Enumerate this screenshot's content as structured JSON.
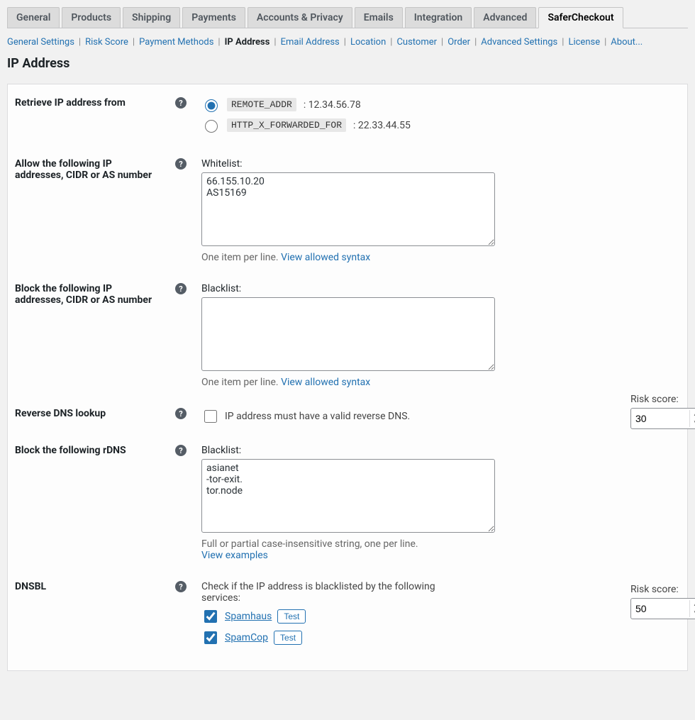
{
  "tabs": [
    "General",
    "Products",
    "Shipping",
    "Payments",
    "Accounts & Privacy",
    "Emails",
    "Integration",
    "Advanced",
    "SaferCheckout"
  ],
  "active_tab": 8,
  "subtabs": [
    "General Settings",
    "Risk Score",
    "Payment Methods",
    "IP Address",
    "Email Address",
    "Location",
    "Customer",
    "Order",
    "Advanced Settings",
    "License",
    "About..."
  ],
  "active_subtab": 3,
  "page_title": "IP Address",
  "retrieve": {
    "label": "Retrieve IP address from",
    "opts": [
      {
        "code": "REMOTE_ADDR",
        "ip": "12.34.56.78",
        "checked": true
      },
      {
        "code": "HTTP_X_FORWARDED_FOR",
        "ip": "22.33.44.55",
        "checked": false
      }
    ]
  },
  "whitelist": {
    "label": "Allow the following IP addresses, CIDR or AS number",
    "field_label": "Whitelist:",
    "value": "66.155.10.20\nAS15169",
    "hint": "One item per line.",
    "hint_link": "View allowed syntax"
  },
  "blacklist": {
    "label": "Block the following IP addresses, CIDR or AS number",
    "field_label": "Blacklist:",
    "value": "",
    "hint": "One item per line.",
    "hint_link": "View allowed syntax"
  },
  "rdns": {
    "label": "Reverse DNS lookup",
    "cb_label": "IP address must have a valid reverse DNS.",
    "checked": false,
    "risk_label": "Risk score:",
    "risk_value": "30"
  },
  "rdns_block": {
    "label": "Block the following rDNS",
    "field_label": "Blacklist:",
    "value": "asianet\n-tor-exit.\ntor.node",
    "hint": "Full or partial case-insensitive string, one per line.",
    "hint_link": "View examples"
  },
  "dnsbl": {
    "label": "DNSBL",
    "intro": "Check if the IP address is blacklisted by the following services:",
    "items": [
      {
        "name": "Spamhaus",
        "checked": true
      },
      {
        "name": "SpamCop",
        "checked": true
      }
    ],
    "test_label": "Test",
    "risk_label": "Risk score:",
    "risk_value": "50"
  }
}
